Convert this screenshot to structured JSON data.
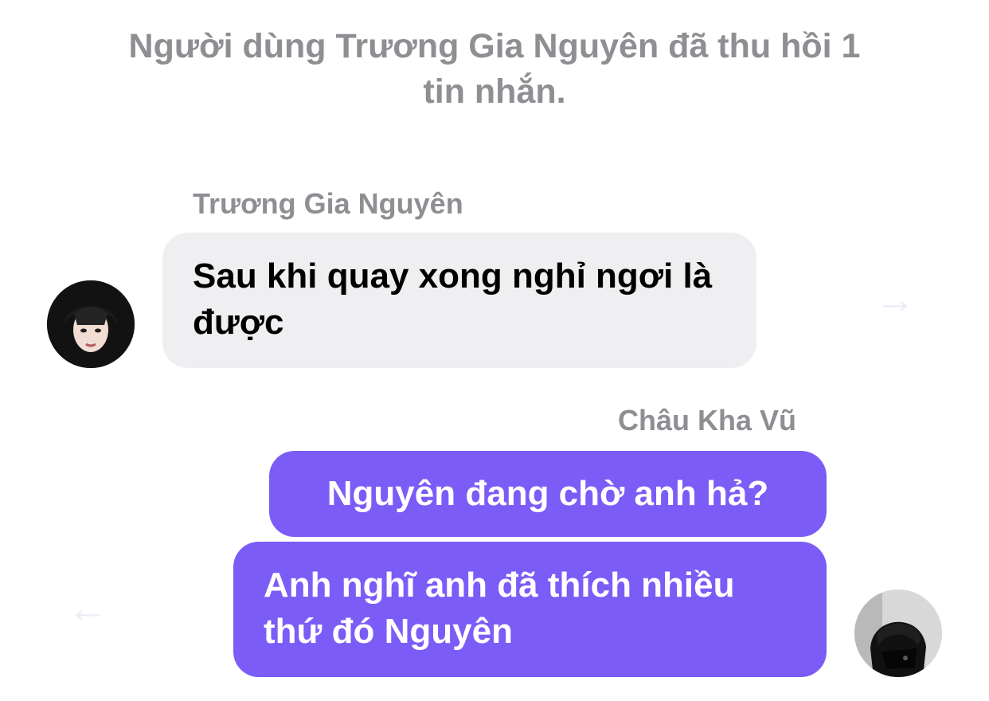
{
  "system_notice": "Người dùng Trương Gia Nguyên đã thu hồi 1 tin nhắn.",
  "messages": [
    {
      "sender": "Trương Gia Nguyên",
      "direction": "incoming",
      "text": "Sau khi quay xong nghỉ ngơi là được"
    },
    {
      "sender": "Châu Kha Vũ",
      "direction": "outgoing",
      "text": "Nguyên đang chờ anh hả?"
    },
    {
      "sender": "Châu Kha Vũ",
      "direction": "outgoing",
      "text": "Anh nghĩ anh đã thích nhiều thứ đó Nguyên"
    }
  ],
  "colors": {
    "outgoing_bubble": "#7b5cf7",
    "incoming_bubble": "#efeff2",
    "meta_text": "#8e8e93"
  },
  "icons": {
    "left_avatar": "avatar",
    "right_avatar": "avatar",
    "right_hint": "arrow-right-icon",
    "left_hint": "arrow-left-icon"
  }
}
